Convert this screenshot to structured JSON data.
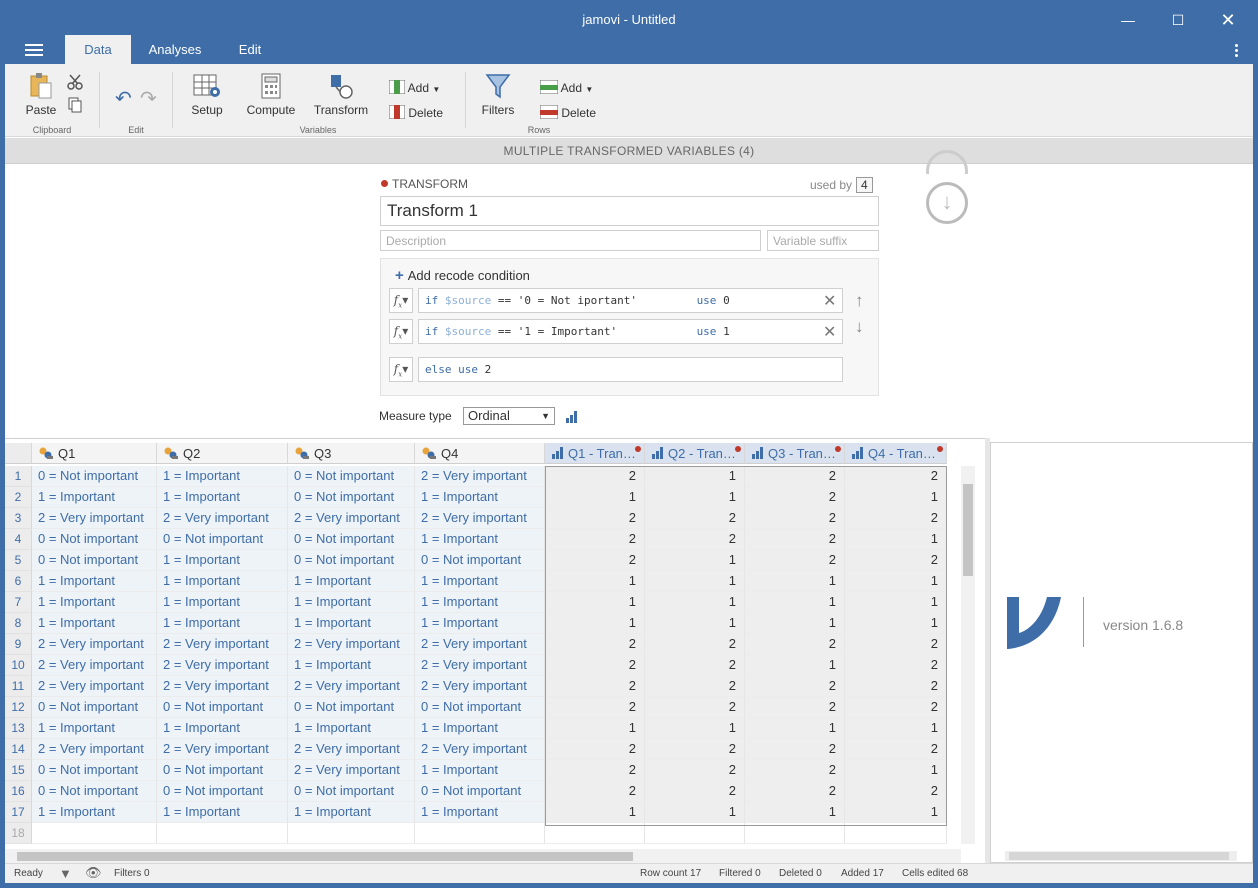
{
  "window": {
    "title": "jamovi - Untitled"
  },
  "tabs": [
    {
      "label": "Data"
    },
    {
      "label": "Analyses"
    },
    {
      "label": "Edit"
    }
  ],
  "ribbon": {
    "paste": "Paste",
    "clipboard_group": "Clipboard",
    "edit_group": "Edit",
    "setup": "Setup",
    "compute": "Compute",
    "transform": "Transform",
    "variables_group": "Variables",
    "var_add": "Add",
    "var_delete": "Delete",
    "filters": "Filters",
    "row_add": "Add",
    "row_delete": "Delete",
    "rows_group": "Rows"
  },
  "editor": {
    "header": "MULTIPLE TRANSFORMED VARIABLES (4)",
    "section_label": "TRANSFORM",
    "used_by_label": "used by",
    "used_by_count": "4",
    "name_value": "Transform 1",
    "description_placeholder": "Description",
    "suffix_placeholder": "Variable suffix",
    "add_condition": "Add recode condition",
    "conditions": [
      {
        "kw_if": "if",
        "src": "$source",
        "op": "==",
        "str": "'0 = Not iportant'",
        "kw_use": "use",
        "val": "0"
      },
      {
        "kw_if": "if",
        "src": "$source",
        "op": "==",
        "str": "'1 = Important'",
        "kw_use": "use",
        "val": "1"
      }
    ],
    "else_kw": "else use",
    "else_val": "2",
    "measure_label": "Measure type",
    "measure_value": "Ordinal"
  },
  "sheet": {
    "columns": [
      "Q1",
      "Q2",
      "Q3",
      "Q4",
      "Q1 - Tran…",
      "Q2 - Tran…",
      "Q3 - Tran…",
      "Q4 - Tran…"
    ],
    "rows": [
      [
        "0 = Not important",
        "1 = Important",
        "0 = Not important",
        "2 = Very important",
        "2",
        "1",
        "2",
        "2"
      ],
      [
        "1 = Important",
        "1 = Important",
        "0 = Not important",
        "1 = Important",
        "1",
        "1",
        "2",
        "1"
      ],
      [
        "2 = Very important",
        "2 = Very important",
        "2 = Very important",
        "2 = Very important",
        "2",
        "2",
        "2",
        "2"
      ],
      [
        "0 = Not important",
        "0 = Not important",
        "0 = Not important",
        "1 = Important",
        "2",
        "2",
        "2",
        "1"
      ],
      [
        "0 = Not important",
        "1 = Important",
        "0 = Not important",
        "0 = Not important",
        "2",
        "1",
        "2",
        "2"
      ],
      [
        "1 = Important",
        "1 = Important",
        "1 = Important",
        "1 = Important",
        "1",
        "1",
        "1",
        "1"
      ],
      [
        "1 = Important",
        "1 = Important",
        "1 = Important",
        "1 = Important",
        "1",
        "1",
        "1",
        "1"
      ],
      [
        "1 = Important",
        "1 = Important",
        "1 = Important",
        "1 = Important",
        "1",
        "1",
        "1",
        "1"
      ],
      [
        "2 = Very important",
        "2 = Very important",
        "2 = Very important",
        "2 = Very important",
        "2",
        "2",
        "2",
        "2"
      ],
      [
        "2 = Very important",
        "2 = Very important",
        "1 = Important",
        "2 = Very important",
        "2",
        "2",
        "1",
        "2"
      ],
      [
        "2 = Very important",
        "2 = Very important",
        "2 = Very important",
        "2 = Very important",
        "2",
        "2",
        "2",
        "2"
      ],
      [
        "0 = Not important",
        "0 = Not important",
        "0 = Not important",
        "0 = Not important",
        "2",
        "2",
        "2",
        "2"
      ],
      [
        "1 = Important",
        "1 = Important",
        "1 = Important",
        "1 = Important",
        "1",
        "1",
        "1",
        "1"
      ],
      [
        "2 = Very important",
        "2 = Very important",
        "2 = Very important",
        "2 = Very important",
        "2",
        "2",
        "2",
        "2"
      ],
      [
        "0 = Not important",
        "0 = Not important",
        "2 = Very important",
        "1 = Important",
        "2",
        "2",
        "2",
        "1"
      ],
      [
        "0 = Not important",
        "0 = Not important",
        "0 = Not important",
        "0 = Not important",
        "2",
        "2",
        "2",
        "2"
      ],
      [
        "1 = Important",
        "1 = Important",
        "1 = Important",
        "1 = Important",
        "1",
        "1",
        "1",
        "1"
      ]
    ],
    "empty_row_number": "18"
  },
  "results": {
    "version": "version 1.6.8"
  },
  "status": {
    "ready": "Ready",
    "filters": "Filters 0",
    "row_count": "Row count 17",
    "filtered": "Filtered 0",
    "deleted": "Deleted 0",
    "added": "Added 17",
    "cells_edited": "Cells edited 68"
  },
  "colors": {
    "accent": "#3e6da8",
    "transform_dot": "#c0392b"
  }
}
